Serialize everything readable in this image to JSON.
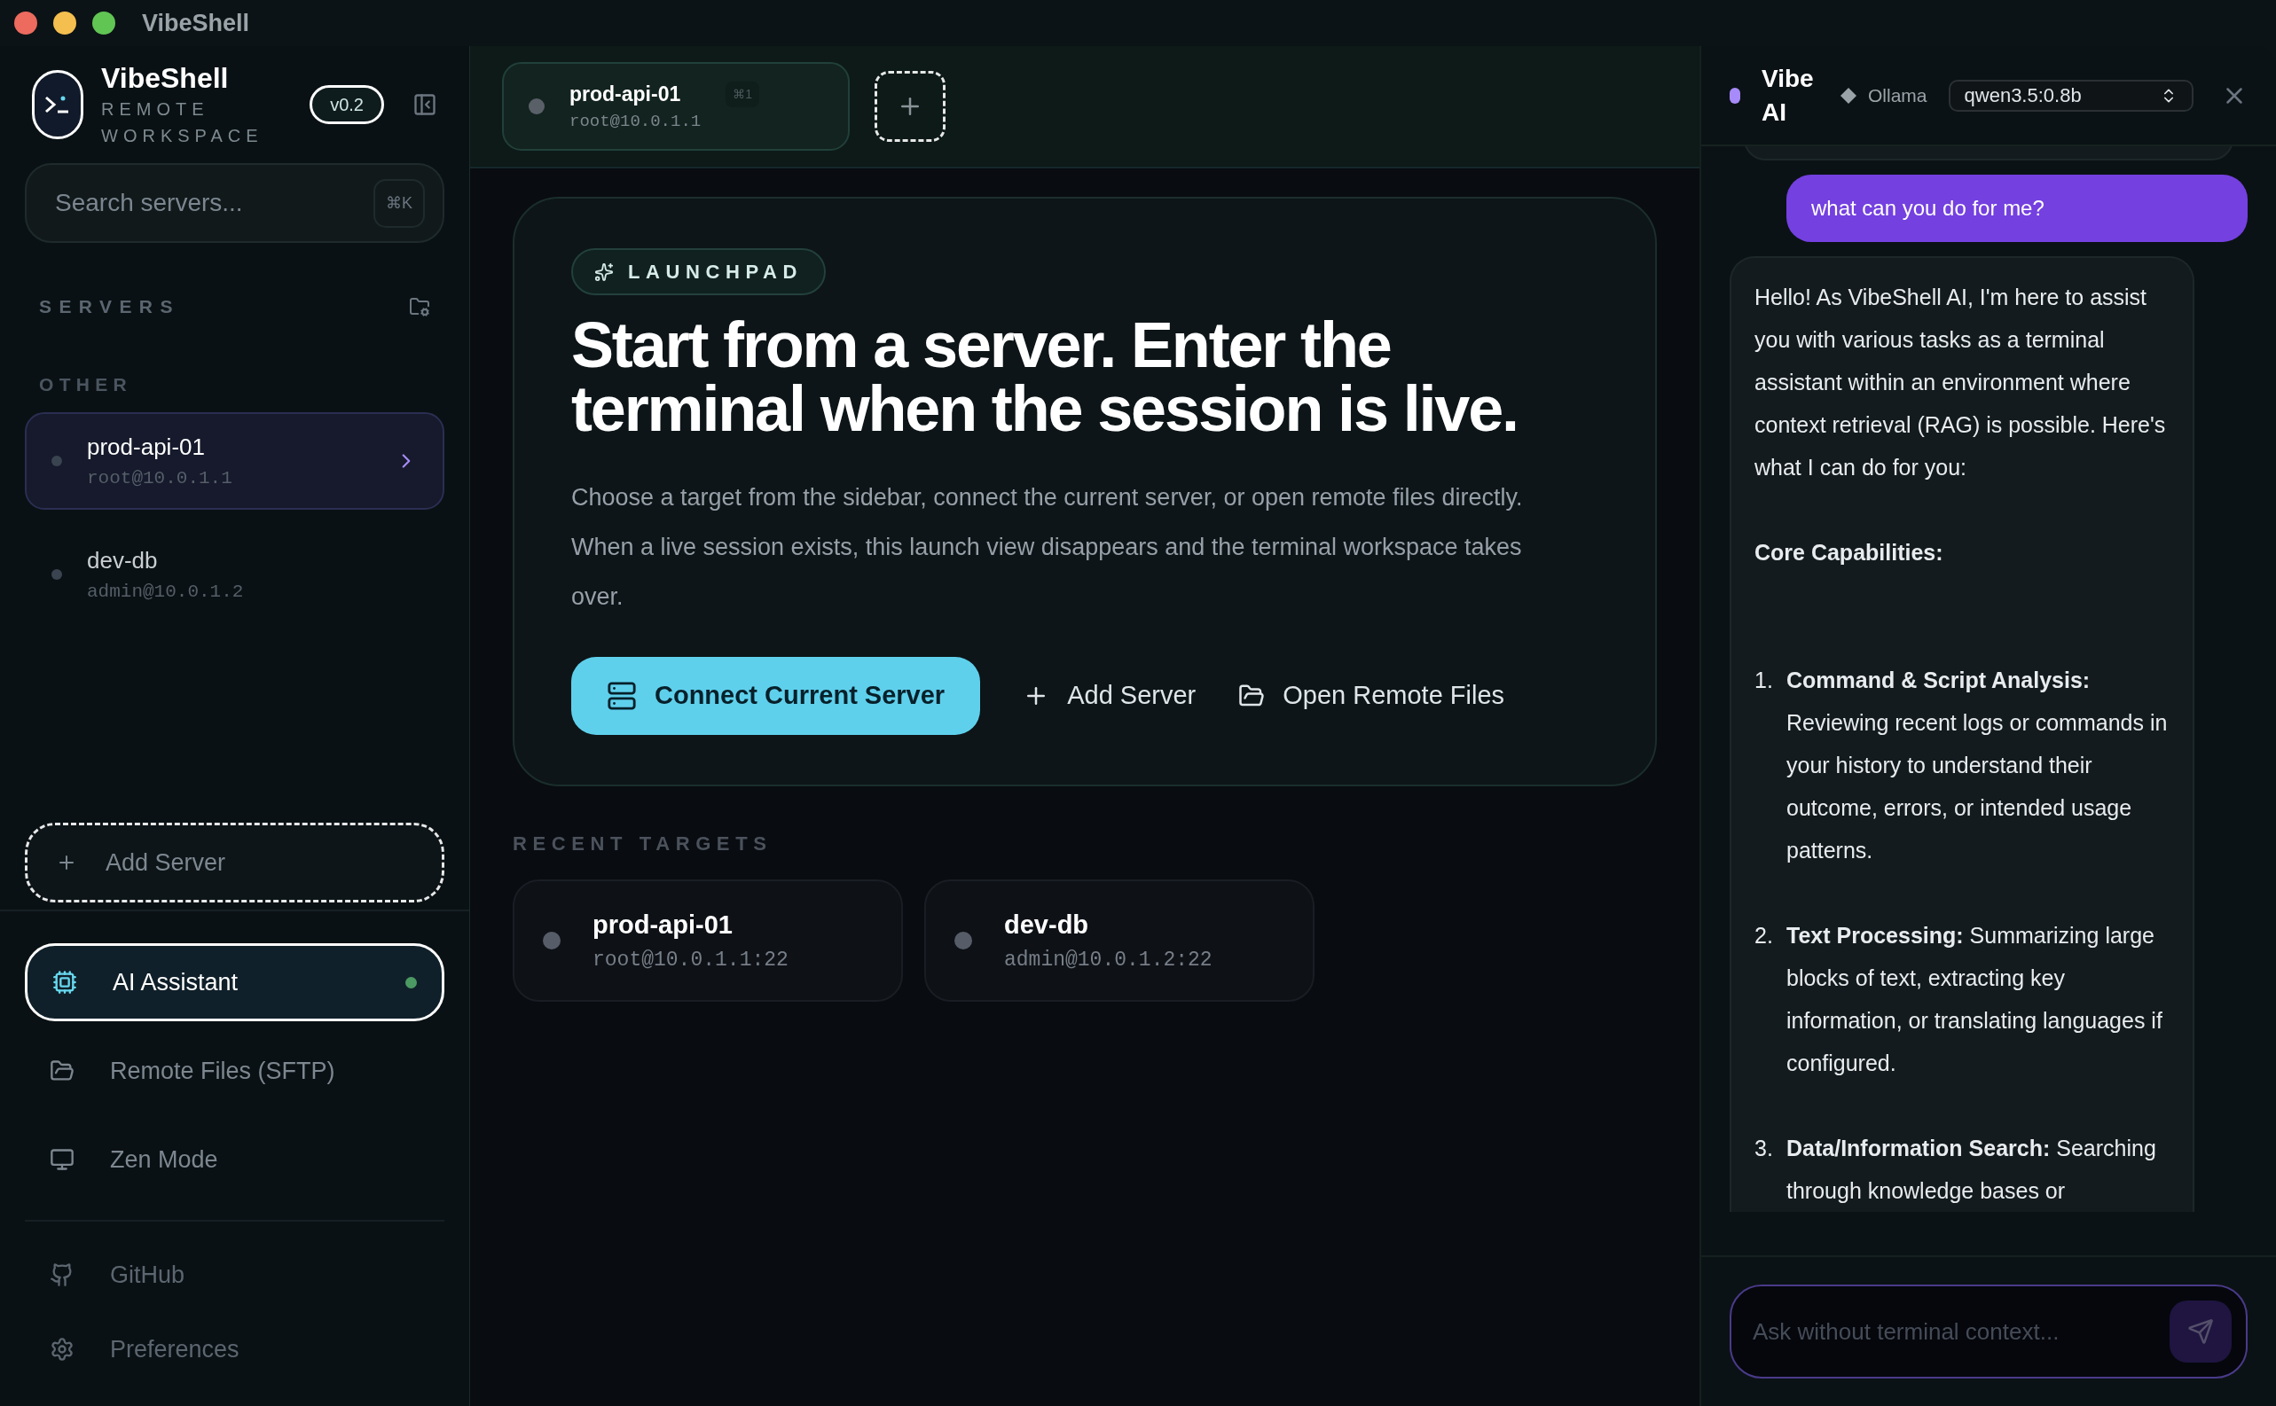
{
  "window": {
    "title": "VibeShell"
  },
  "sidebar": {
    "brand": {
      "name": "VibeShell",
      "subtitle": "REMOTE WORKSPACE",
      "version": "v0.2"
    },
    "search": {
      "placeholder": "Search servers...",
      "shortcut": "⌘K"
    },
    "servers_label": "SERVERS",
    "groups": [
      {
        "name": "OTHER",
        "servers": [
          {
            "name": "prod-api-01",
            "address": "root@10.0.1.1",
            "selected": true
          },
          {
            "name": "dev-db",
            "address": "admin@10.0.1.2",
            "selected": false
          }
        ]
      }
    ],
    "add_server": "Add Server",
    "nav": [
      {
        "label": "AI Assistant",
        "selected": true,
        "status_dot": true
      },
      {
        "label": "Remote Files (SFTP)",
        "selected": false,
        "status_dot": false
      },
      {
        "label": "Zen Mode",
        "selected": false,
        "status_dot": false
      }
    ],
    "footer": [
      {
        "label": "GitHub"
      },
      {
        "label": "Preferences"
      }
    ]
  },
  "tabs": [
    {
      "name": "prod-api-01",
      "address": "root@10.0.1.1",
      "shortcut": "⌘1",
      "selected": true
    }
  ],
  "launchpad": {
    "badge": "LAUNCHPAD",
    "heading": "Start from a server. Enter the terminal when the session is live.",
    "description": "Choose a target from the sidebar, connect the current server, or open remote files directly. When a live session exists, this launch view disappears and the terminal workspace takes over.",
    "actions": [
      {
        "label": "Connect Current Server",
        "kind": "primary"
      },
      {
        "label": "Add Server",
        "kind": "plain"
      },
      {
        "label": "Open Remote Files",
        "kind": "plain"
      }
    ]
  },
  "recent": {
    "label": "RECENT TARGETS",
    "targets": [
      {
        "name": "prod-api-01",
        "address": "root@10.0.1.1:22"
      },
      {
        "name": "dev-db",
        "address": "admin@10.0.1.2:22"
      }
    ]
  },
  "assistant": {
    "title": "Vibe AI",
    "provider": "Ollama",
    "model": "qwen3.5:0.8b",
    "messages": [
      {
        "kind": "user",
        "text": "what can you do for me?"
      },
      {
        "kind": "assistant",
        "blocks": [
          {
            "kind": "paragraph",
            "text": "Hello! As VibeShell AI, I'm here to assist you with various tasks as a terminal assistant within an environment where context retrieval (RAG) is possible. Here's what I can do for you:"
          },
          {
            "kind": "heading",
            "text": "Core Capabilities:"
          },
          {
            "kind": "list",
            "items": [
              {
                "number": "1.",
                "text": "**Command & Script Analysis:** Reviewing recent logs or commands in your history to understand their outcome, errors, or intended usage patterns."
              },
              {
                "number": "2.",
                "text": "**Text Processing:** Summarizing large blocks of text, extracting key information, or translating languages if configured."
              },
              {
                "number": "3.",
                "text": "**Data/Information Search:** Searching through knowledge bases or"
              }
            ]
          }
        ]
      }
    ],
    "input": {
      "placeholder": "Ask without terminal context..."
    }
  }
}
